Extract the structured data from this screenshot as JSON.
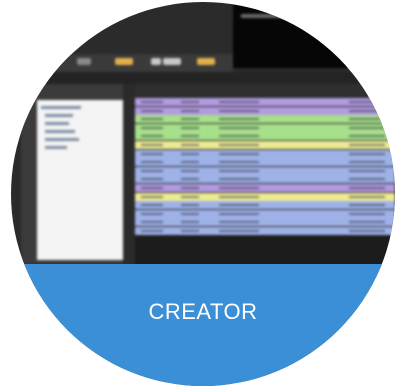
{
  "banner": {
    "label": "CREATOR",
    "color": "#3b8fd6"
  },
  "screenshot": {
    "row_colors": [
      "#b39be0",
      "#b39be0",
      "#a7e08a",
      "#a7e08a",
      "#a7e08a",
      "#eeea93",
      "#9fb2e8",
      "#9fb2e8",
      "#9fb2e8",
      "#9fb2e8",
      "#b39be0",
      "#eeea93",
      "#9fb2e8",
      "#9fb2e8",
      "#9fb2e8",
      "#9fb2e8"
    ]
  }
}
